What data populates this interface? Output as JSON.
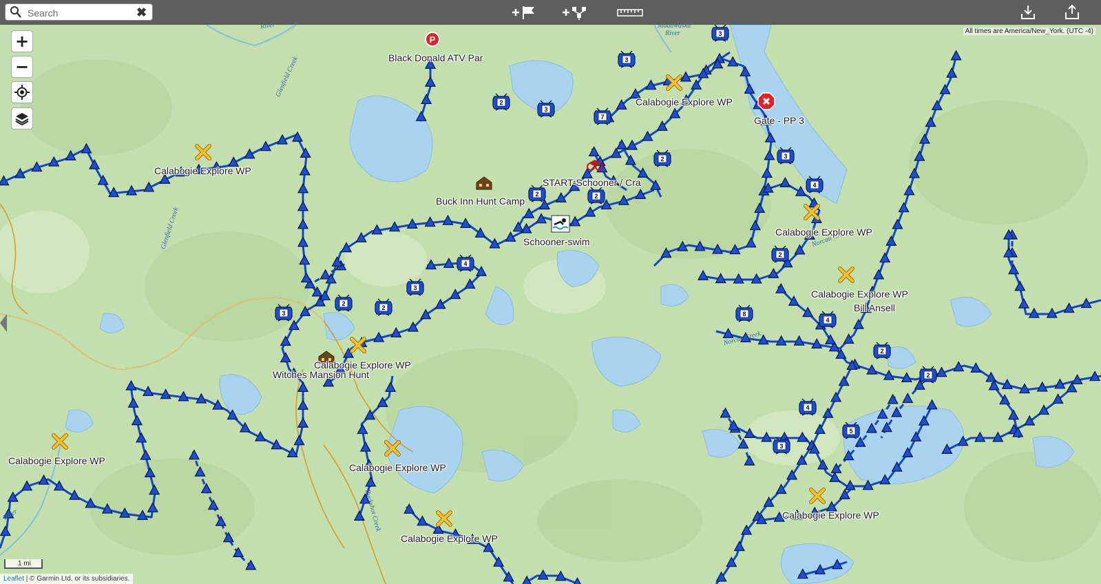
{
  "search": {
    "placeholder": "Search",
    "value": ""
  },
  "toolbar": {
    "add_waypoint_icon": "add-flag-icon",
    "add_route_icon": "add-route-icon",
    "measure_icon": "ruler-icon",
    "download_icon": "download-icon",
    "share_icon": "share-icon"
  },
  "map_controls": {
    "zoom_in": "+",
    "zoom_out": "−"
  },
  "timezone_note": "All times are America/New_York. (UTC -4)",
  "scale": "1 mi",
  "attribution": {
    "leaflet": "Leaflet",
    "rest": " | © Garmin Ltd. or its subsidiaries."
  },
  "labels": [
    {
      "id": "black-donald",
      "text": "Black Donald ATV Par"
    },
    {
      "id": "calabogie-1",
      "text": "Calabogie Explore WP"
    },
    {
      "id": "gate",
      "text": "Gate - PP 3"
    },
    {
      "id": "calabogie-2",
      "text": "Calabogie Explore WP"
    },
    {
      "id": "start",
      "text": "START-Schooner / Cra"
    },
    {
      "id": "buck-inn",
      "text": "Buck Inn Hunt Camp"
    },
    {
      "id": "calabogie-3",
      "text": "Calabogie Explore WP"
    },
    {
      "id": "schooner-swim",
      "text": "Schooner-swim"
    },
    {
      "id": "calabogie-4",
      "text": "Calabogie Explore WP"
    },
    {
      "id": "bill-ansell",
      "text": "Bill Ansell"
    },
    {
      "id": "calabogie-5",
      "text": "Calabogie Explore WP"
    },
    {
      "id": "witches",
      "text": "Witches Mansion Hunt"
    },
    {
      "id": "calabogie-6",
      "text": "Calabogie Explore WP"
    },
    {
      "id": "calabogie-7",
      "text": "Calabogie Explore WP"
    },
    {
      "id": "calabogie-8",
      "text": "Calabogie Explore WP"
    },
    {
      "id": "calabogie-9",
      "text": "Calabogie Explore WP"
    }
  ],
  "river_labels": [
    {
      "text": "River"
    },
    {
      "text": "Madawaska River"
    },
    {
      "text": "Glenfield Creek"
    },
    {
      "text": "Glenfield Creek"
    },
    {
      "text": "Norcan Creek"
    },
    {
      "text": "Norcan Creek"
    },
    {
      "text": "Buckshot Creek"
    },
    {
      "text": "River"
    }
  ],
  "clusters": [
    "3",
    "2",
    "3",
    "7",
    "2",
    "3",
    "4",
    "2",
    "4",
    "3",
    "2",
    "2",
    "3",
    "2",
    "8",
    "4",
    "2",
    "4",
    "5",
    "3",
    "2"
  ],
  "colors": {
    "track": "#1147c4",
    "triangle": "#1c4fd8",
    "outline": "#0a1a4a",
    "water": "#a9d3ef",
    "land": "#c6e0af",
    "x_marker": "#f2c230",
    "gate": "#e0222b"
  }
}
